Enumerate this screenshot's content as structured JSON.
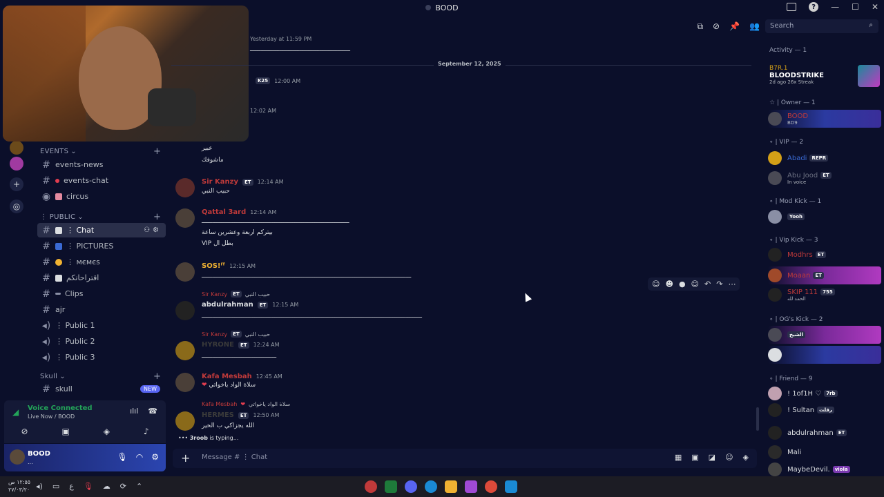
{
  "window": {
    "title": "BOOD"
  },
  "topbar": {
    "search_placeholder": "Search"
  },
  "sidebar": {
    "categories": [
      {
        "label": "EVENTS"
      },
      {
        "label": "⋮ PUBLIC"
      },
      {
        "label": "Skull"
      }
    ],
    "channels": [
      {
        "label": "events-news"
      },
      {
        "label": "events-chat"
      },
      {
        "label": "circus"
      },
      {
        "label": "⋮ Chat"
      },
      {
        "label": "⋮ PICTURES"
      },
      {
        "label": "⋮ мємєѕ"
      },
      {
        "label": "اقتراحاتكم"
      },
      {
        "label": "Clips"
      },
      {
        "label": "ajr"
      },
      {
        "label": "⋮ Public 1"
      },
      {
        "label": "⋮ Public 2"
      },
      {
        "label": "⋮ Public 3"
      },
      {
        "label": "skull",
        "badge": "NEW"
      }
    ]
  },
  "voice": {
    "title": "Voice Connected",
    "subtitle": "Live Now / BOOD"
  },
  "user": {
    "name": "BOOD",
    "status": "..."
  },
  "messages": {
    "date_separator": "September 12, 2025",
    "items": [
      {
        "time": "Yesterday at 11:59 PM",
        "line": "ـــــــــــــــــــــــــــــــــــــــــــــــــــــــ"
      },
      {
        "tag": "K25",
        "time": "12:00 AM"
      },
      {
        "time": "12:02 AM"
      },
      {
        "line1": "عبير",
        "line2": "ماشوفك"
      },
      {
        "name": "Sir Kanzy",
        "tag": "ET",
        "time": "12:14 AM",
        "line": "حبيب النبي"
      },
      {
        "name": "Qattal 3ard",
        "time": "12:14 AM",
        "line1": "ـــــــــــــــــــــــــــــــــــــــــــــــــــــــــــــــــــــــــــــــــ",
        "line2": "بيتركم اربعة وعشرين ساعة",
        "line3": "VIP بطل ال"
      },
      {
        "name": "SOS!ᴵᵀ",
        "time": "12:15 AM",
        "line": "ـــــــــــــــــــــــــــــــــــــــــــــــــــــــــــــــــــــــــــــــــــــــــــــــــــــــــــــــــــ"
      },
      {
        "reply_name": "Sir Kanzy",
        "reply_tag": "ET",
        "reply_text": "حبيب النبي",
        "name": "abdulrahman",
        "tag": "ET",
        "time": "12:15 AM",
        "line": "ـــــــــــــــــــــــــــــــــــــــــــــــــــــــــــــــــــــــــــــــــــــــــــــــــــــــــــــــــــــــــ"
      },
      {
        "reply_name": "Sir Kanzy",
        "reply_tag": "ET",
        "reply_text": "حبيب النبي",
        "name": "HYRONE",
        "tag": "ET",
        "time": "12:24 AM",
        "line": "ـــــــــــــــــــــــــــــــــــــــــ"
      },
      {
        "name": "Kafa Mesbah",
        "time": "12:45 AM",
        "line": "سلاة الواد ياخواتي"
      },
      {
        "reply_name": "Kafa Mesbah",
        "reply_text": "سلاة الواد ياخواتي",
        "name": "HERMES",
        "tag": "ET",
        "time": "12:50 AM",
        "line": "الله يجزاكي ب الخير"
      }
    ],
    "typing": {
      "user": "3roob",
      "text": "is typing..."
    }
  },
  "composer": {
    "placeholder": "Message # ⋮ Chat"
  },
  "members": {
    "activity": {
      "header": "Activity — 1",
      "game": "B7R.1",
      "title": "BLOODSTRIKE",
      "sub": "2d ago  26x Streak"
    },
    "groups": [
      {
        "header": "☆ | Owner — 1"
      },
      {
        "header": "∘ | VIP — 2"
      },
      {
        "header": "∘ | Mod Kick — 1"
      },
      {
        "header": "∘ | Vip Kick — 3"
      },
      {
        "header": "∘ | OG's Kick — 2"
      },
      {
        "header": "∘ | Friend — 9"
      }
    ],
    "list": [
      {
        "name": "BOOD",
        "sub": "BD9",
        "tag": ""
      },
      {
        "name": "Abadi",
        "tag": "REPR"
      },
      {
        "name": "Abu Jood",
        "tag": "ET",
        "sub": "In voice"
      },
      {
        "name": "",
        "tag": "Yooh"
      },
      {
        "name": "Modhrs",
        "tag": "ET"
      },
      {
        "name": "Moaan",
        "tag": "ET"
      },
      {
        "name": "SKIP 111",
        "tag": "755",
        "sub": "الحمد لله"
      },
      {
        "name": "",
        "tag": "الشيخ"
      },
      {
        "name": "",
        "tag": ""
      },
      {
        "name": "! 1of1H ♡",
        "tag": "7rb"
      },
      {
        "name": "! Sultan",
        "tag": "رقلت"
      },
      {
        "name": "abdulrahman",
        "tag": "ET"
      },
      {
        "name": "Mali",
        "tag": ""
      },
      {
        "name": "MaybeDevil.",
        "tag": "viola"
      }
    ]
  },
  "taskbar": {
    "time": "١٢:٥٥ ص",
    "date": "٢٧/٠٣/٢٠"
  },
  "colors": {
    "accent": "#5865f2",
    "bg": "#0b0f2a",
    "online": "#23a559",
    "role_red": "#c03a3a"
  }
}
